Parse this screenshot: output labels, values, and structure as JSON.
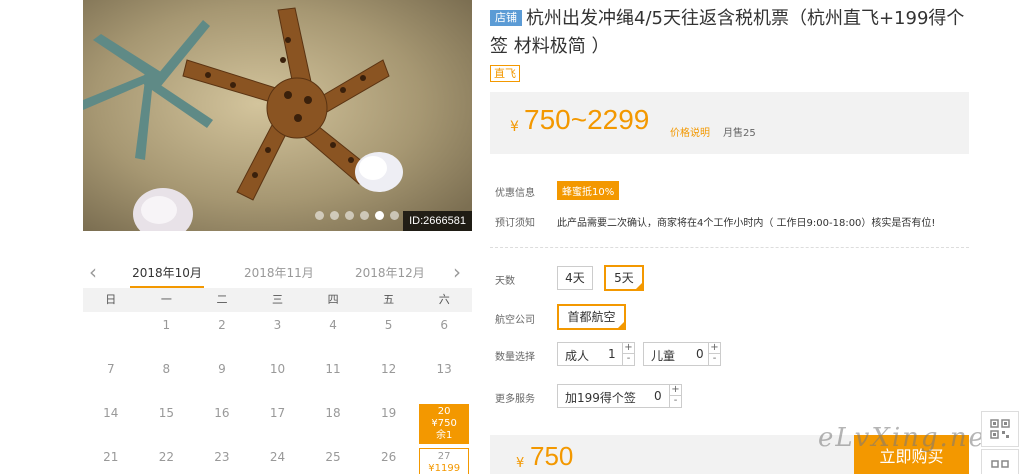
{
  "hero": {
    "image_id": "ID:2666581",
    "dots": [
      0,
      0,
      0,
      0,
      1,
      0
    ]
  },
  "calendar": {
    "months": [
      "2018年10月",
      "2018年11月",
      "2018年12月"
    ],
    "weekdays": [
      "日",
      "一",
      "二",
      "三",
      "四",
      "五",
      "六"
    ],
    "rows": [
      [
        "",
        "1",
        "2",
        "3",
        "4",
        "5",
        "6"
      ],
      [
        "7",
        "8",
        "9",
        "10",
        "11",
        "12",
        "13"
      ],
      [
        "14",
        "15",
        "16",
        "17",
        "18",
        "19",
        "20"
      ],
      [
        "21",
        "22",
        "23",
        "24",
        "25",
        "26",
        "27"
      ]
    ],
    "selected": {
      "day": "20",
      "price": "¥750",
      "stock": "余1"
    },
    "available": {
      "day": "27",
      "price": "¥1199"
    }
  },
  "product": {
    "shop_badge": "店铺",
    "title": "杭州出发冲绳4/5天往返含税机票（杭州直飞+199得个签 材料极简 ）",
    "direct_tag": "直飞",
    "price_yen": "¥",
    "price_range": "750~2299",
    "price_explain": "价格说明",
    "monthly_sales": "月售25"
  },
  "info": {
    "promo_label": "优惠信息",
    "promo_badge": "蜂蜜抵10%",
    "notice_label": "预订须知",
    "notice_text": "此产品需要二次确认，商家将在4个工作小时内（ 工作日9:00-18:00）核实是否有位!"
  },
  "options": {
    "days_label": "天数",
    "days": [
      "4天",
      "5天"
    ],
    "days_selected": "5天",
    "airline_label": "航空公司",
    "airline": "首都航空",
    "qty_label": "数量选择",
    "adult_label": "成人",
    "adult_value": "1",
    "child_label": "儿童",
    "child_value": "0",
    "more_label": "更多服务",
    "addon_label": "加199得个签",
    "addon_value": "0",
    "plus": "+",
    "minus": "-"
  },
  "bottom": {
    "yen": "¥",
    "total": "750",
    "buy_label": "立即购买"
  },
  "watermark": "eLvXing.net",
  "colors": {
    "accent": "#f39800",
    "badge_blue": "#5b9bd5"
  }
}
